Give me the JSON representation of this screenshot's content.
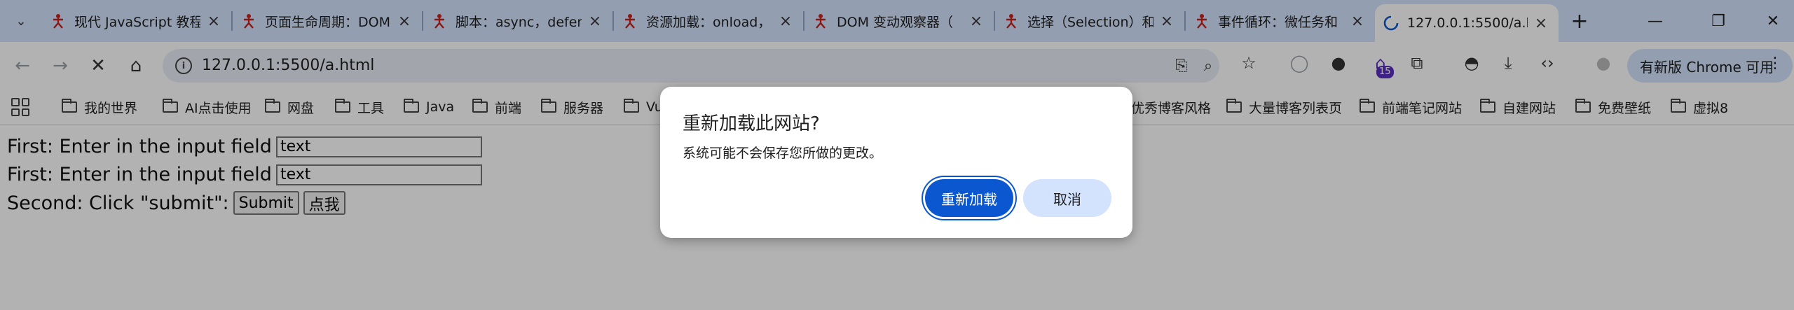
{
  "tabs": [
    {
      "title": "现代 JavaScript 教程"
    },
    {
      "title": "页面生命周期：DOM"
    },
    {
      "title": "脚本：async，defer"
    },
    {
      "title": "资源加载：onload，"
    },
    {
      "title": "DOM 变动观察器（"
    },
    {
      "title": "选择（Selection）和"
    },
    {
      "title": "事件循环：微任务和"
    },
    {
      "title": "127.0.0.1:5500/a.html"
    }
  ],
  "omnibox": {
    "url": "127.0.0.1:5500/a.html"
  },
  "toolbar": {
    "update_label": "有新版 Chrome 可用",
    "ext_badge": "15"
  },
  "bookmarks": [
    "我的世界",
    "AI点击使用",
    "网盘",
    "工具",
    "Java",
    "前端",
    "服务器",
    "Vu",
    "优秀博客风格",
    "大量博客列表页",
    "前端笔记网站",
    "自建网站",
    "免费壁纸",
    "虚拟8"
  ],
  "page": {
    "row1_label": "First: Enter in the input field",
    "row1_value": "text",
    "row2_label": "First: Enter in the input field",
    "row2_value": "text",
    "row3_label": "Second: Click \"submit\":",
    "submit_label": "Submit",
    "click_label": "点我"
  },
  "dialog": {
    "title": "重新加载此网站?",
    "body": "系统可能不会保存您所做的更改。",
    "reload_label": "重新加载",
    "cancel_label": "取消"
  },
  "colors": {
    "accent": "#0b57d0",
    "tabstrip": "#d3e3fd",
    "favicon": "#c5221f"
  }
}
